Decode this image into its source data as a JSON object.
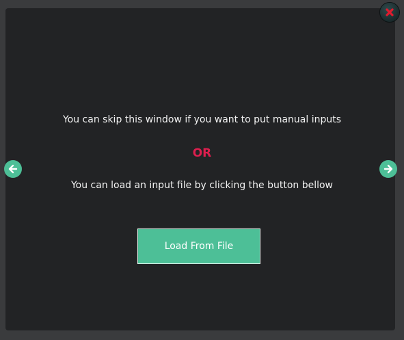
{
  "dialog": {
    "skip_text": "You can skip this window if you want to put manual inputs",
    "or_text": "OR",
    "load_text": "You can load an input file by clicking the button bellow",
    "load_button_label": "Load From File"
  },
  "icons": {
    "close": "close-icon",
    "prev": "arrow-left-icon",
    "next": "arrow-right-icon"
  },
  "colors": {
    "accent": "#4dbf97",
    "or_text": "#dc1f4e",
    "background": "#222325",
    "close_x": "#e01b2e"
  }
}
